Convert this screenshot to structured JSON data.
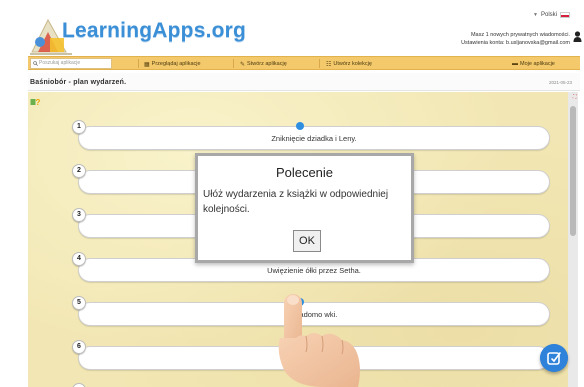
{
  "header": {
    "logo_text": "LearningApps.org",
    "language": "Polski",
    "messages_text": "Masz 1 nowych prywatnych wiadomości.",
    "account_text": "Ustawienia konta: b.usljanovska@gmail.com"
  },
  "navbar": {
    "search_placeholder": "Poszukaj aplikacje",
    "browse_label": "Przeglądaj aplikacje",
    "create_label": "Stwórz aplikację",
    "collection_label": "Utwórz kolekcję",
    "my_apps_label": "Moje aplikacje"
  },
  "app": {
    "title": "Baśniobór - plan wydarzeń.",
    "date": "2021-05-23"
  },
  "items": [
    {
      "number": "1",
      "text": "Zniknięcie dziadka i Leny."
    },
    {
      "number": "2",
      "text": ""
    },
    {
      "number": "3",
      "text": ""
    },
    {
      "number": "4",
      "text": "Uwięzienie         ółki przez Setha."
    },
    {
      "number": "5",
      "text": "Wiadomo                            wki."
    },
    {
      "number": "6",
      "text": "Przyjazd d                          sonów."
    }
  ],
  "modal": {
    "title": "Polecenie",
    "text": "Ułóż wydarzenia z książki w odpowiedniej kolejności.",
    "ok_label": "OK"
  },
  "colors": {
    "accent_blue": "#2e8fe0",
    "navbar_orange": "#f4c96b",
    "content_bg": "#f2e7b4"
  }
}
